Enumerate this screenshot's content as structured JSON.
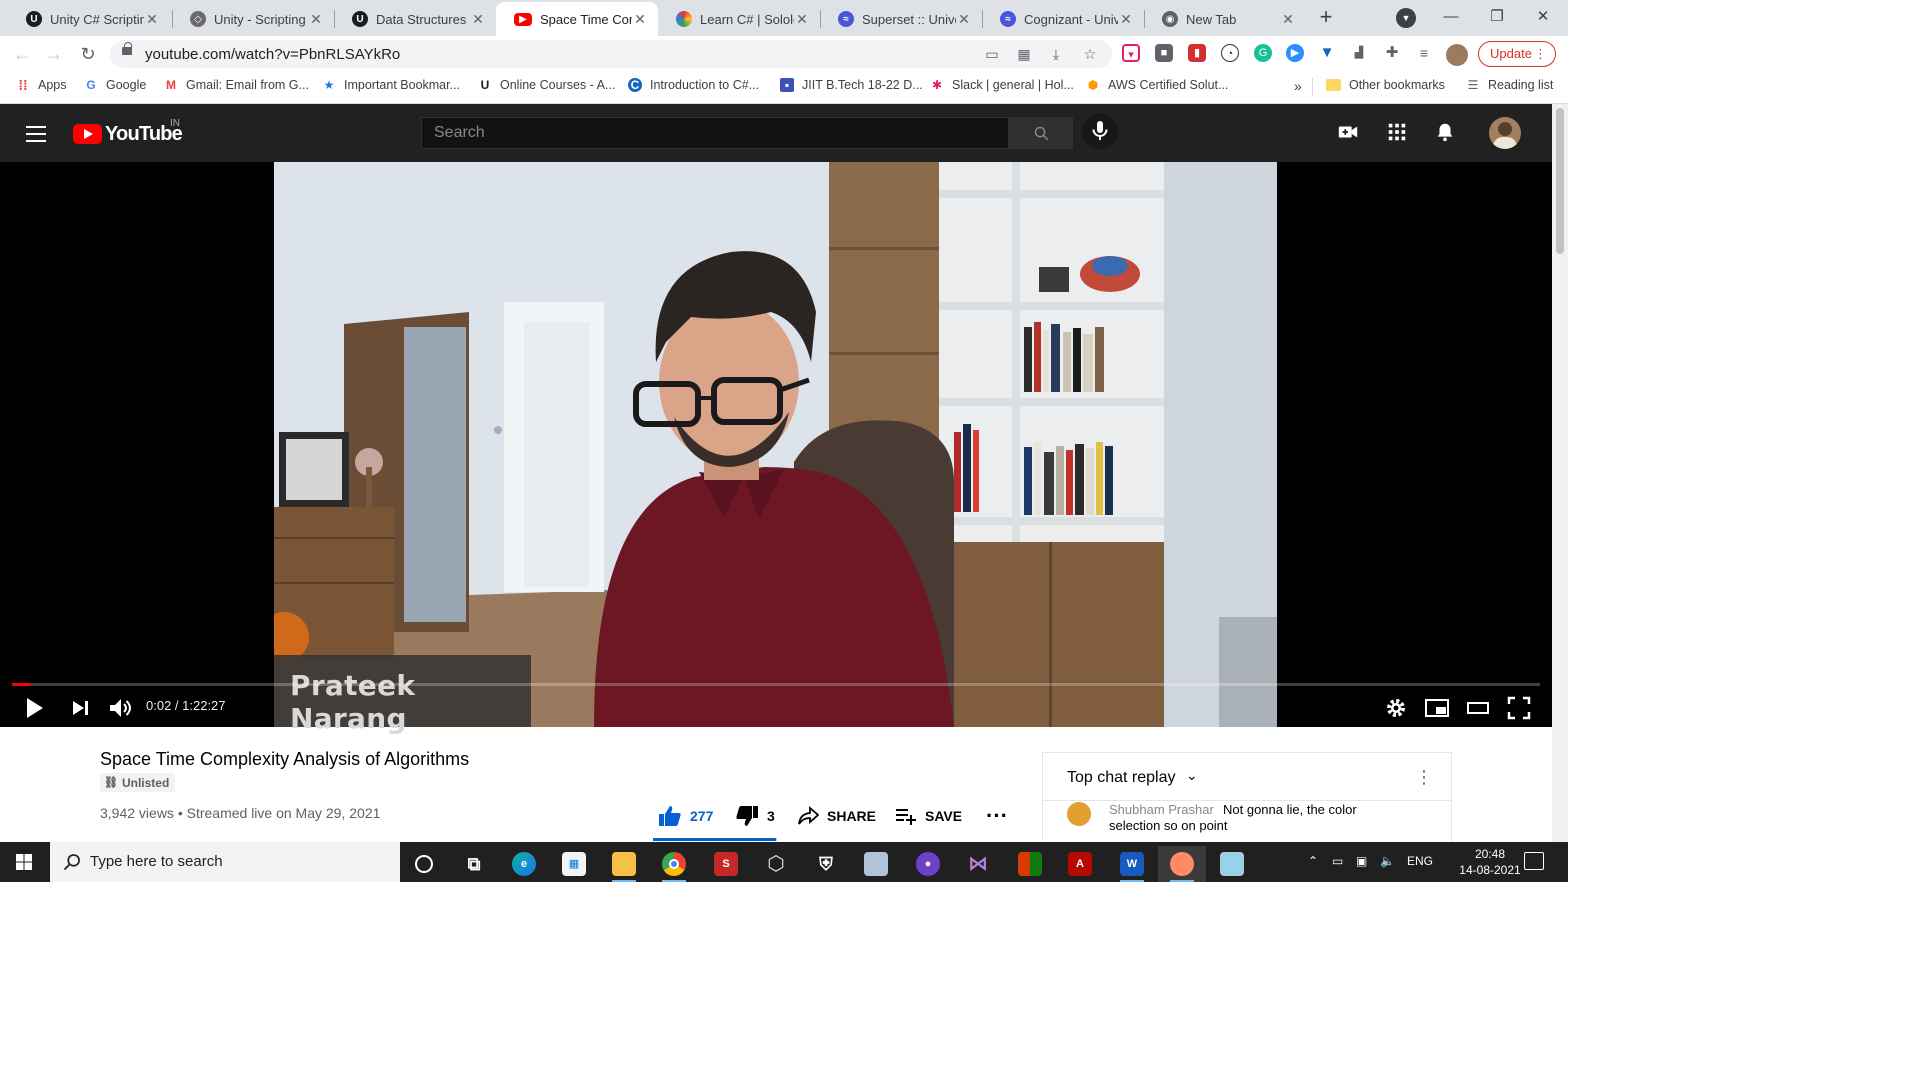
{
  "browser": {
    "tabs": [
      {
        "title": "Unity C# Scripting",
        "favicon": "udemy-icon",
        "color": "#1c1d1f",
        "active": false
      },
      {
        "title": "Unity - Scripting A",
        "favicon": "unity-icon",
        "color": "#6b6b6b",
        "active": false
      },
      {
        "title": "Data Structures &",
        "favicon": "udemy-icon",
        "color": "#1c1d1f",
        "active": false
      },
      {
        "title": "Space Time Comp",
        "favicon": "youtube-icon",
        "color": "#ff0000",
        "active": true
      },
      {
        "title": "Learn C# | Sololea",
        "favicon": "sololearn-icon",
        "color": "#3c6df0",
        "active": false
      },
      {
        "title": "Superset :: Univer",
        "favicon": "superset-icon",
        "color": "#4a56d6",
        "active": false
      },
      {
        "title": "Cognizant - Unive",
        "favicon": "superset-icon",
        "color": "#4a56d6",
        "active": false
      },
      {
        "title": "New Tab",
        "favicon": "chrome-icon",
        "color": "#5f6368",
        "active": false
      }
    ],
    "url": "youtube.com/watch?v=PbnRLSAYkRo",
    "update_label": "Update",
    "bookmarks": [
      {
        "label": "Apps",
        "icon": "apps-grid-icon"
      },
      {
        "label": "Google",
        "icon": "google-icon"
      },
      {
        "label": "Gmail: Email from G...",
        "icon": "gmail-icon"
      },
      {
        "label": "Important Bookmar...",
        "icon": "star-icon"
      },
      {
        "label": "Online Courses - A...",
        "icon": "udemy-icon"
      },
      {
        "label": "Introduction to C#...",
        "icon": "c-logo-icon"
      },
      {
        "label": "JIIT B.Tech 18-22 D...",
        "icon": "classroom-icon"
      },
      {
        "label": "Slack | general | Hol...",
        "icon": "slack-icon"
      },
      {
        "label": "AWS Certified Solut...",
        "icon": "aws-icon"
      }
    ],
    "bookmarks_overflow": "»",
    "other_bookmarks": "Other bookmarks",
    "reading_list": "Reading list"
  },
  "youtube": {
    "logo_text": "YouTube",
    "country_code": "IN",
    "search_placeholder": "Search",
    "video": {
      "overlay_name": "Prateek Narang",
      "current_time": "0:02",
      "duration": "1:22:27",
      "time_display": "0:02 / 1:22:27",
      "progress_fraction": 0.0004
    },
    "title": "Space Time Complexity Analysis of Algorithms",
    "visibility_badge": "Unlisted",
    "views": "3,942 views",
    "streamed": "Streamed live on May 29, 2021",
    "view_info": "3,942 views • Streamed live on May 29, 2021",
    "likes": "277",
    "dislikes": "3",
    "like_ratio": 0.989,
    "share_label": "SHARE",
    "save_label": "SAVE",
    "chat": {
      "title": "Top chat replay",
      "messages": [
        {
          "author": "Shubham Prashar",
          "text": "Not gonna lie, the color selection so on point"
        }
      ]
    }
  },
  "taskbar": {
    "search_placeholder": "Type here to search",
    "language": "ENG",
    "time": "20:48",
    "date": "14-08-2021",
    "apps": [
      "cortana-icon",
      "task-view-icon",
      "edge-icon",
      "store-icon",
      "file-explorer-icon",
      "chrome-icon",
      "app-red-icon",
      "unity-icon",
      "security-icon",
      "app-blue-icon",
      "github-desktop-icon",
      "visual-studio-icon",
      "office-icon",
      "acrobat-icon",
      "word-icon",
      "paint-icon",
      "notepad-icon"
    ]
  }
}
